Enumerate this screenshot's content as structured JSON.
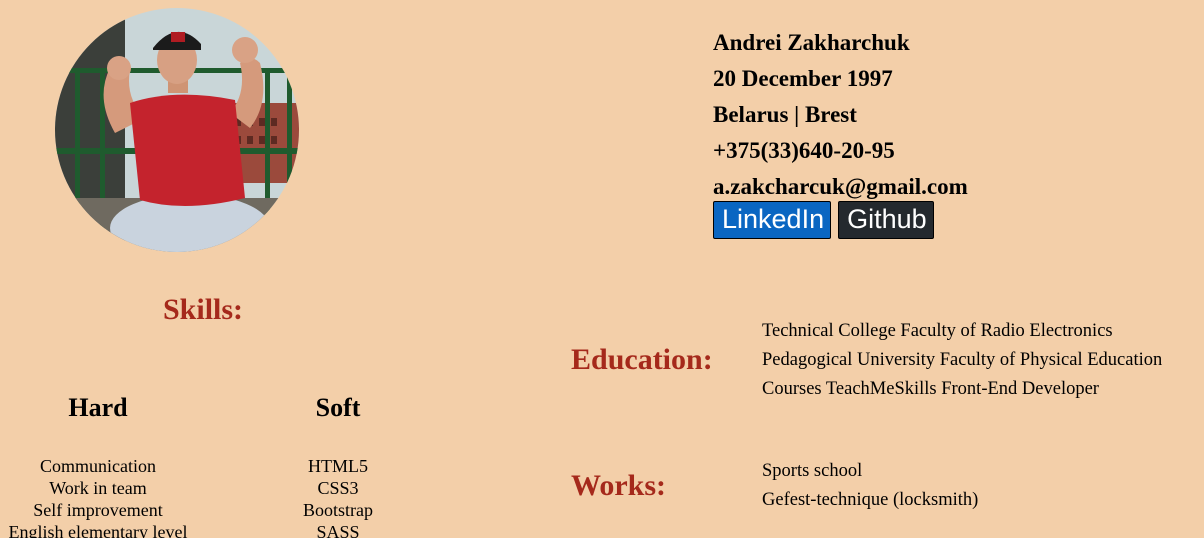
{
  "profile": {
    "name": "Andrei Zakharchuk",
    "birthdate": "20 December 1997",
    "location": "Belarus | Brest",
    "phone": "+375(33)640-20-95",
    "email": "a.zakcharcuk@gmail.com"
  },
  "social": {
    "linkedin_label": "LinkedIn",
    "github_label": "Github"
  },
  "skills": {
    "title": "Skills:",
    "hard_title": "Hard",
    "soft_title": "Soft",
    "hard_items": [
      "Communication",
      "Work in team",
      "Self improvement",
      "English elementary level"
    ],
    "soft_items": [
      "HTML5",
      "CSS3",
      "Bootstrap",
      "SASS"
    ]
  },
  "education": {
    "title": "Education:",
    "items": [
      "Technical College Faculty of Radio Electronics",
      "Pedagogical University Faculty of Physical Education",
      "Courses TeachMeSkills Front-End Developer"
    ]
  },
  "works": {
    "title": "Works:",
    "items": [
      "Sports school",
      "Gefest-technique (locksmith)"
    ]
  },
  "colors": {
    "background": "#f3cfa9",
    "section_heading": "#a5291b",
    "linkedin": "#0a66c2",
    "github": "#24292e"
  }
}
